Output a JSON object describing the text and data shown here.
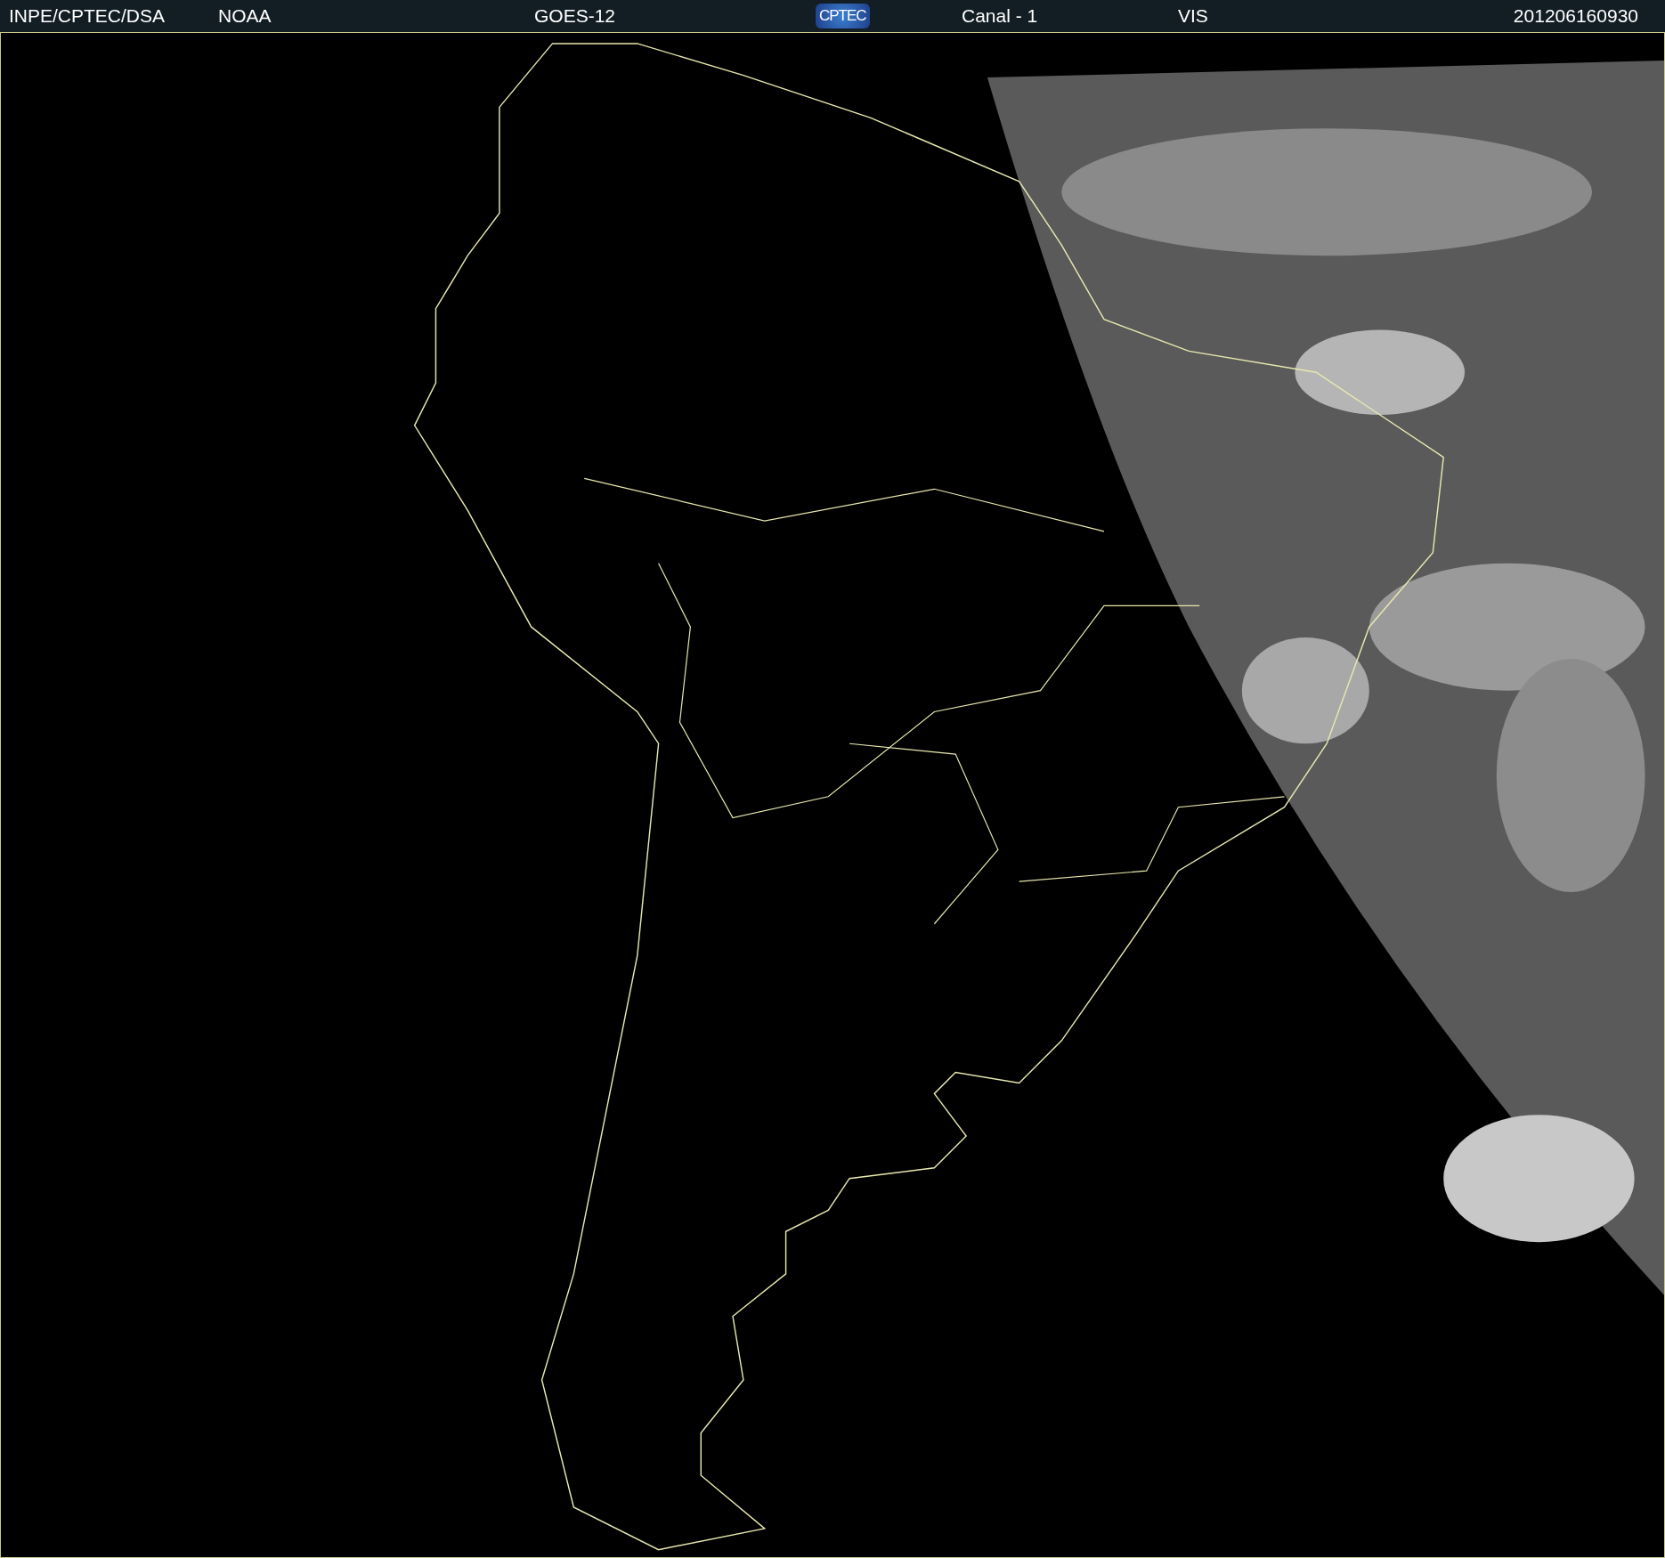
{
  "header": {
    "items": [
      {
        "kind": "text",
        "text": "INPE/CPTEC/DSA"
      },
      {
        "kind": "text",
        "text": "NOAA"
      },
      {
        "kind": "text",
        "text": "GOES-12"
      },
      {
        "kind": "logo",
        "text": "CPTEC"
      },
      {
        "kind": "text",
        "text": "Canal - 1"
      },
      {
        "kind": "text",
        "text": "VIS"
      },
      {
        "kind": "text",
        "text": "201206160930"
      }
    ]
  }
}
